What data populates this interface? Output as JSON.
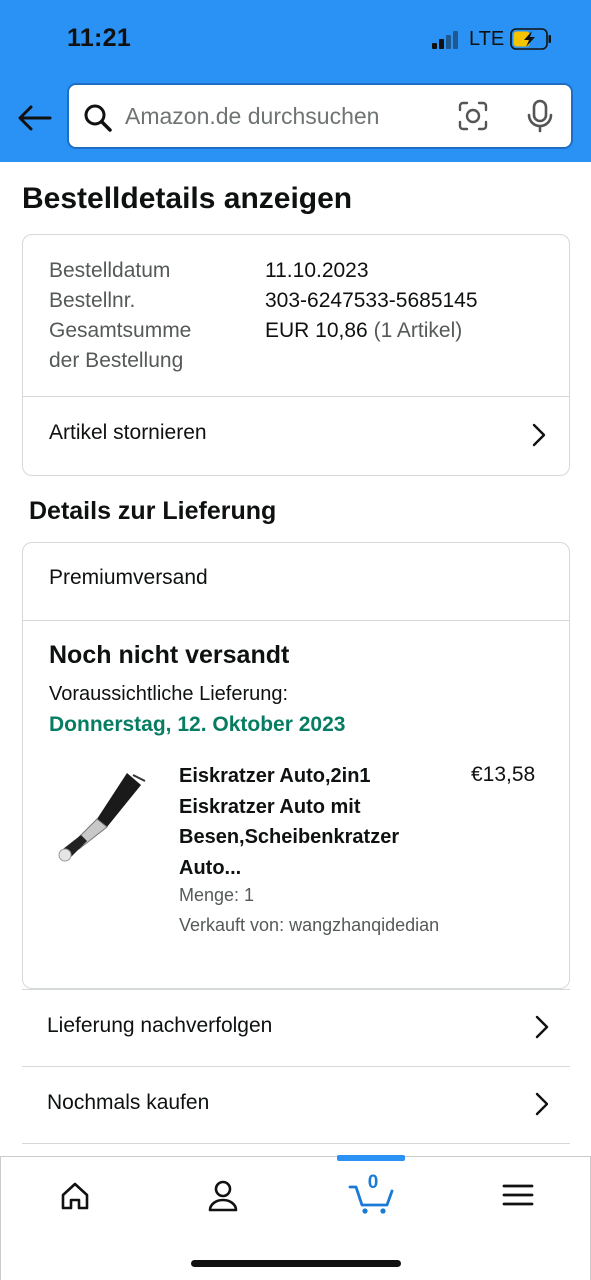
{
  "status_bar": {
    "time": "11:21",
    "network": "LTE"
  },
  "search": {
    "placeholder": "Amazon.de durchsuchen"
  },
  "page_title": "Bestelldetails anzeigen",
  "order_summary": {
    "date_label": "Bestelldatum",
    "date_value": "11.10.2023",
    "number_label": "Bestellnr.",
    "number_value": "303-6247533-5685145",
    "total_label_line1": "Gesamtsumme",
    "total_label_line2": "der Bestellung",
    "total_value": "EUR 10,86",
    "total_items": "(1 Artikel)",
    "cancel_label": "Artikel stornieren"
  },
  "delivery": {
    "section_title": "Details zur Lieferung",
    "shipping_method": "Premiumversand",
    "status": "Noch nicht versandt",
    "eta_label": "Voraussichtliche Lieferung:",
    "eta_date": "Donnerstag, 12. Oktober 2023",
    "item": {
      "title_lines": [
        "Eiskratzer Auto,2in1",
        "Eiskratzer Auto mit",
        "Besen,Scheibenkratzer",
        "Auto..."
      ],
      "price": "€13,58",
      "quantity": "Menge: 1",
      "seller": "Verkauft von: wangzhanqidedian"
    }
  },
  "actions": {
    "track": "Lieferung nachverfolgen",
    "buy_again": "Nochmals kaufen"
  },
  "tabbar": {
    "cart_count": "0"
  },
  "colors": {
    "header_blue": "#2b92f5",
    "delivery_green": "#067d62",
    "cart_blue": "#1a7bd6"
  },
  "icons": [
    "back-arrow-icon",
    "search-icon",
    "camera-icon",
    "mic-icon",
    "chevron-right-icon",
    "home-icon",
    "profile-icon",
    "cart-icon",
    "menu-icon"
  ]
}
